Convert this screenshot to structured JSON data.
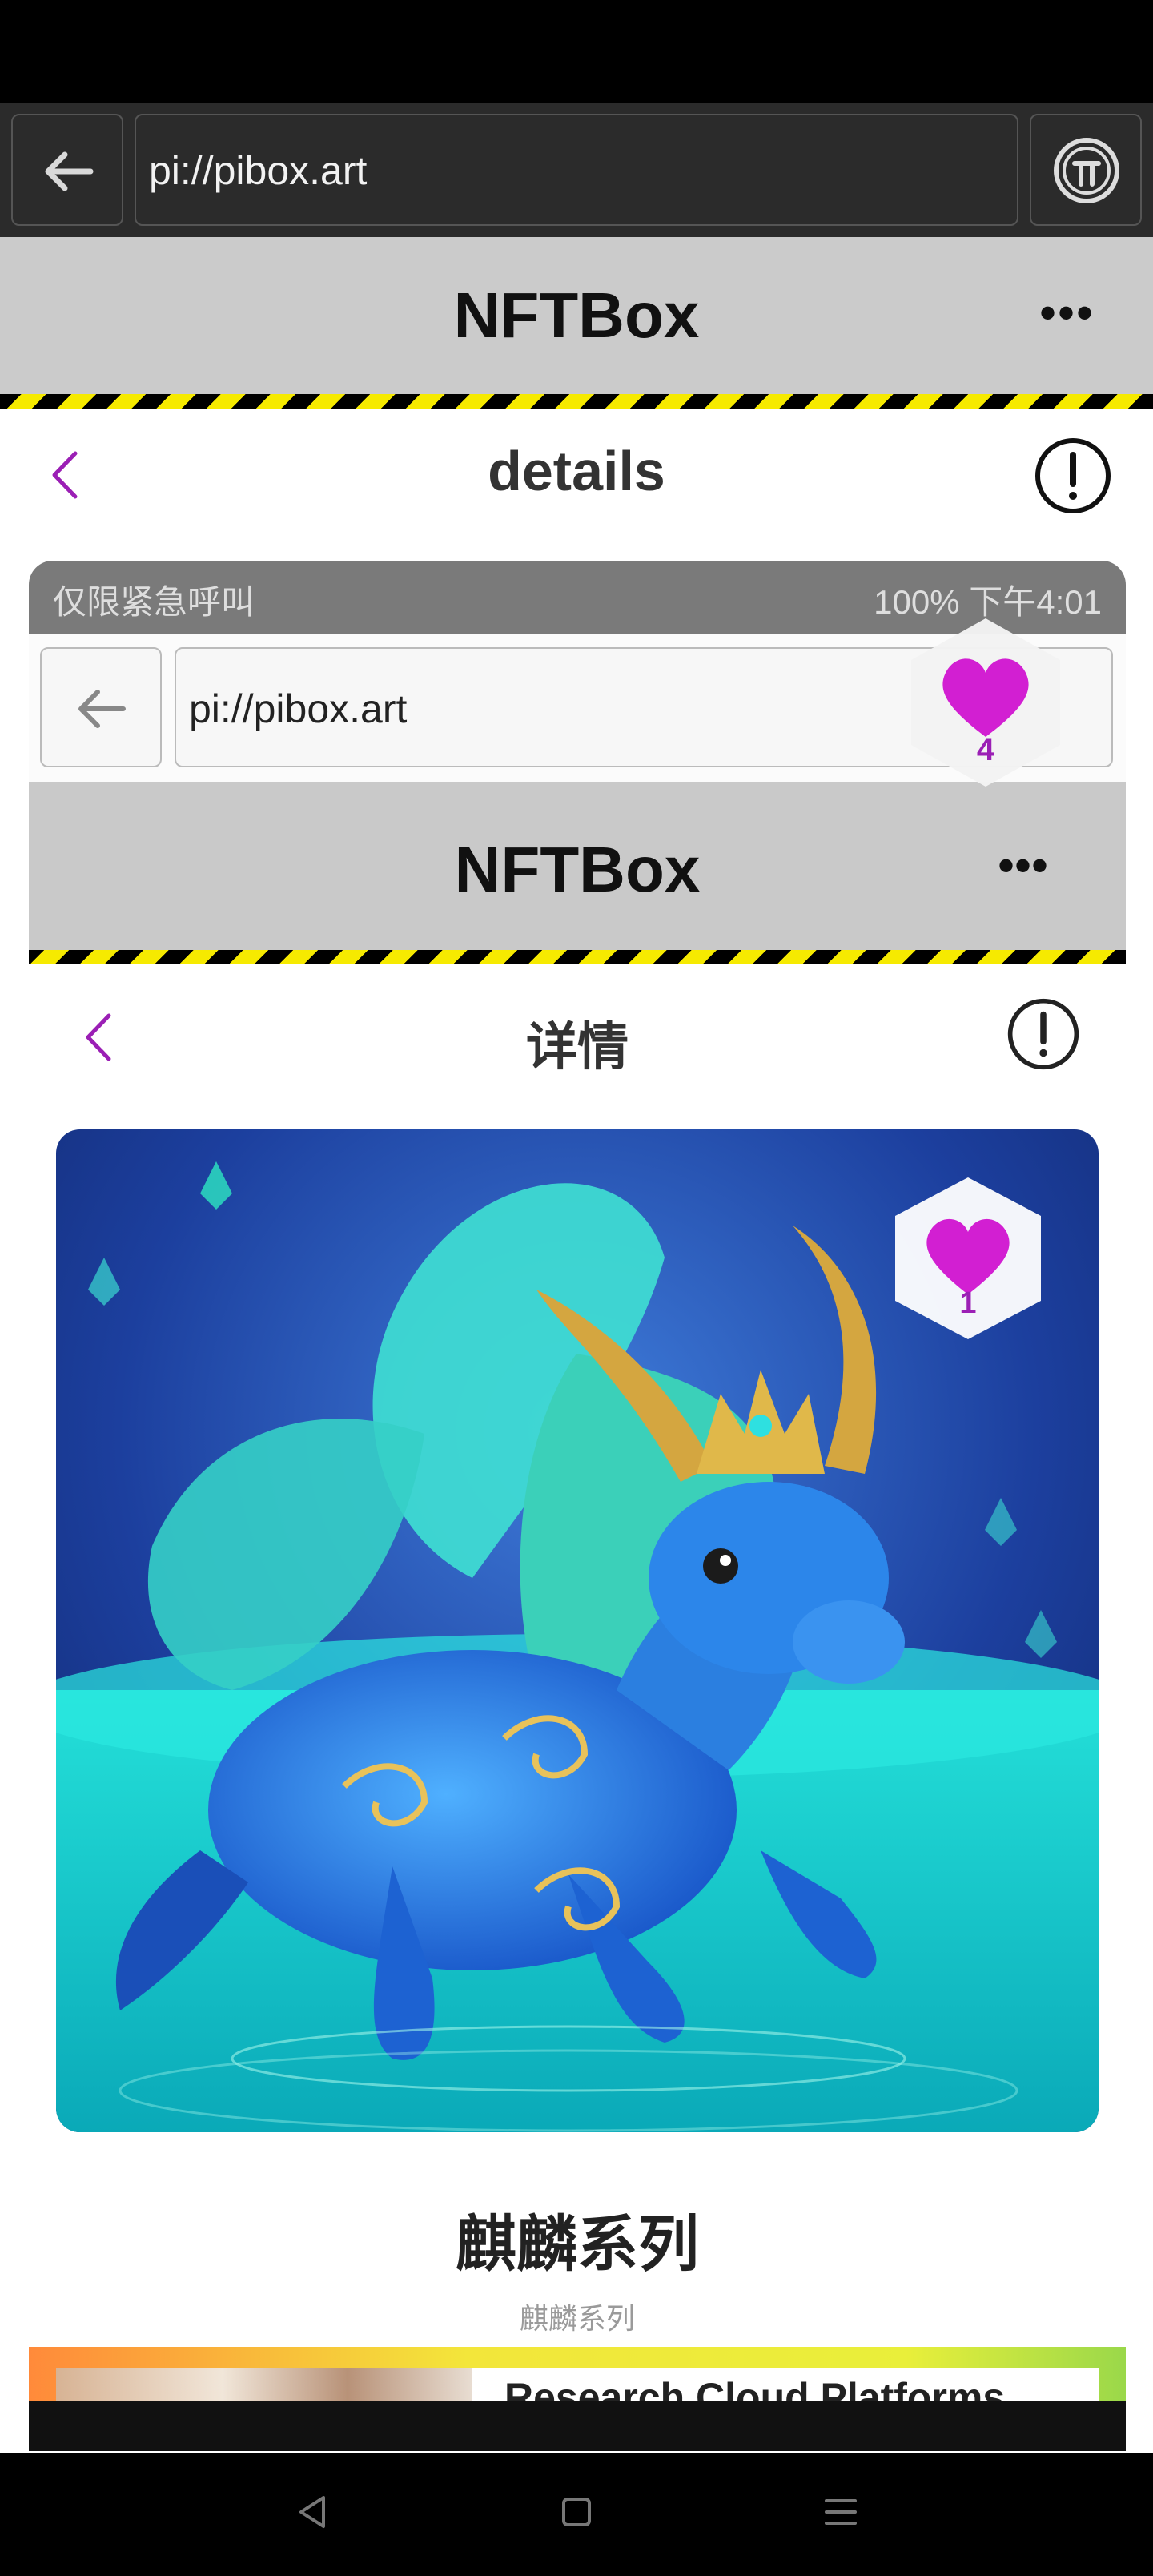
{
  "browser": {
    "url": "pi://pibox.art",
    "app_title": "NFTBox",
    "more_label": "•••",
    "page_label": "details"
  },
  "embedded": {
    "status_left": "仅限紧急呼叫",
    "status_right": "100%  下午4:01",
    "url": "pi://pibox.art",
    "app_title": "NFTBox",
    "more_label": "•••",
    "page_label": "详情",
    "like_count_outer": "4",
    "like_count_inner": "1",
    "collection_title": "麒麟系列",
    "collection_subtitle": "麒麟系列",
    "promo_text": "Research Cloud Platforms"
  },
  "colors": {
    "accent": "#9b1fb5",
    "heart": "#d21fd2",
    "hazard_yellow": "#f6ea00"
  },
  "icons": [
    "back-arrow-icon",
    "pi-logo-icon",
    "more-icon",
    "chevron-left-icon",
    "info-icon",
    "heart-icon",
    "back-triangle-icon",
    "home-square-icon",
    "menu-lines-icon"
  ]
}
